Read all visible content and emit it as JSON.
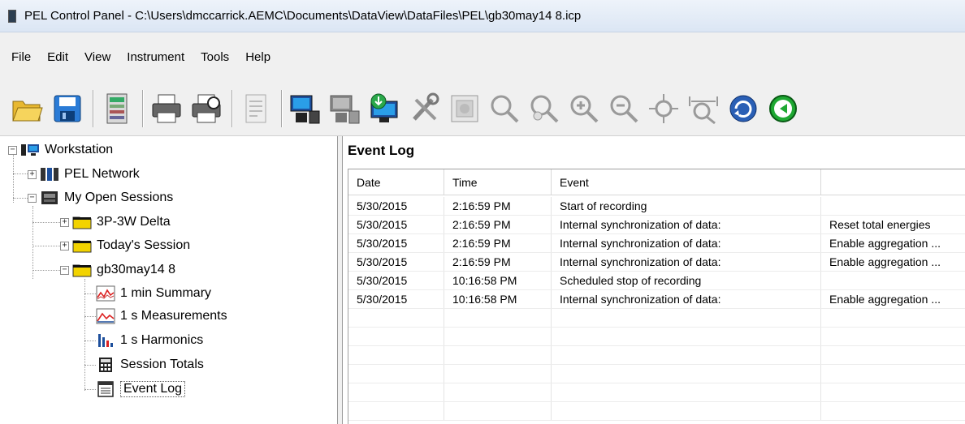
{
  "window": {
    "title": "PEL Control Panel - C:\\Users\\dmccarrick.AEMC\\Documents\\DataView\\DataFiles\\PEL\\gb30may14 8.icp"
  },
  "menu": [
    "File",
    "Edit",
    "View",
    "Instrument",
    "Tools",
    "Help"
  ],
  "toolbar": [
    {
      "icon": "open-folder-icon"
    },
    {
      "icon": "save-icon"
    },
    {
      "icon": "report-icon"
    },
    {
      "icon": "print-icon"
    },
    {
      "icon": "print-preview-icon"
    },
    {
      "icon": "document-disabled-icon"
    },
    {
      "icon": "connect-instrument-icon"
    },
    {
      "icon": "disconnect-instrument-icon"
    },
    {
      "icon": "download-icon"
    },
    {
      "icon": "configure-tools-icon"
    },
    {
      "icon": "stop-icon"
    },
    {
      "icon": "zoom-icon"
    },
    {
      "icon": "zoom-reset-icon"
    },
    {
      "icon": "zoom-in-icon"
    },
    {
      "icon": "zoom-out-icon"
    },
    {
      "icon": "pan-icon"
    },
    {
      "icon": "zoom-fit-icon"
    },
    {
      "icon": "refresh-icon"
    },
    {
      "icon": "back-icon"
    }
  ],
  "tree": {
    "workstation": "Workstation",
    "pel_network": "PEL Network",
    "my_open_sessions": "My Open Sessions",
    "sessions": [
      "3P-3W Delta",
      "Today's Session",
      "gb30may14 8"
    ],
    "children": [
      "1 min Summary",
      "1 s Measurements",
      "1 s Harmonics",
      "Session Totals",
      "Event Log"
    ]
  },
  "panel": {
    "title": "Event Log",
    "columns": [
      "Date",
      "Time",
      "Event",
      ""
    ],
    "rows": [
      [
        "5/30/2015",
        "2:16:59 PM",
        "Start of recording",
        ""
      ],
      [
        "5/30/2015",
        "2:16:59 PM",
        "Internal synchronization of data:",
        "Reset total energies"
      ],
      [
        "5/30/2015",
        "2:16:59 PM",
        "Internal synchronization of data:",
        "Enable aggregation ..."
      ],
      [
        "5/30/2015",
        "2:16:59 PM",
        "Internal synchronization of data:",
        "Enable aggregation ..."
      ],
      [
        "5/30/2015",
        "10:16:58 PM",
        "Scheduled stop of recording",
        ""
      ],
      [
        "5/30/2015",
        "10:16:58 PM",
        "Internal synchronization of data:",
        "Enable aggregation ..."
      ]
    ]
  }
}
